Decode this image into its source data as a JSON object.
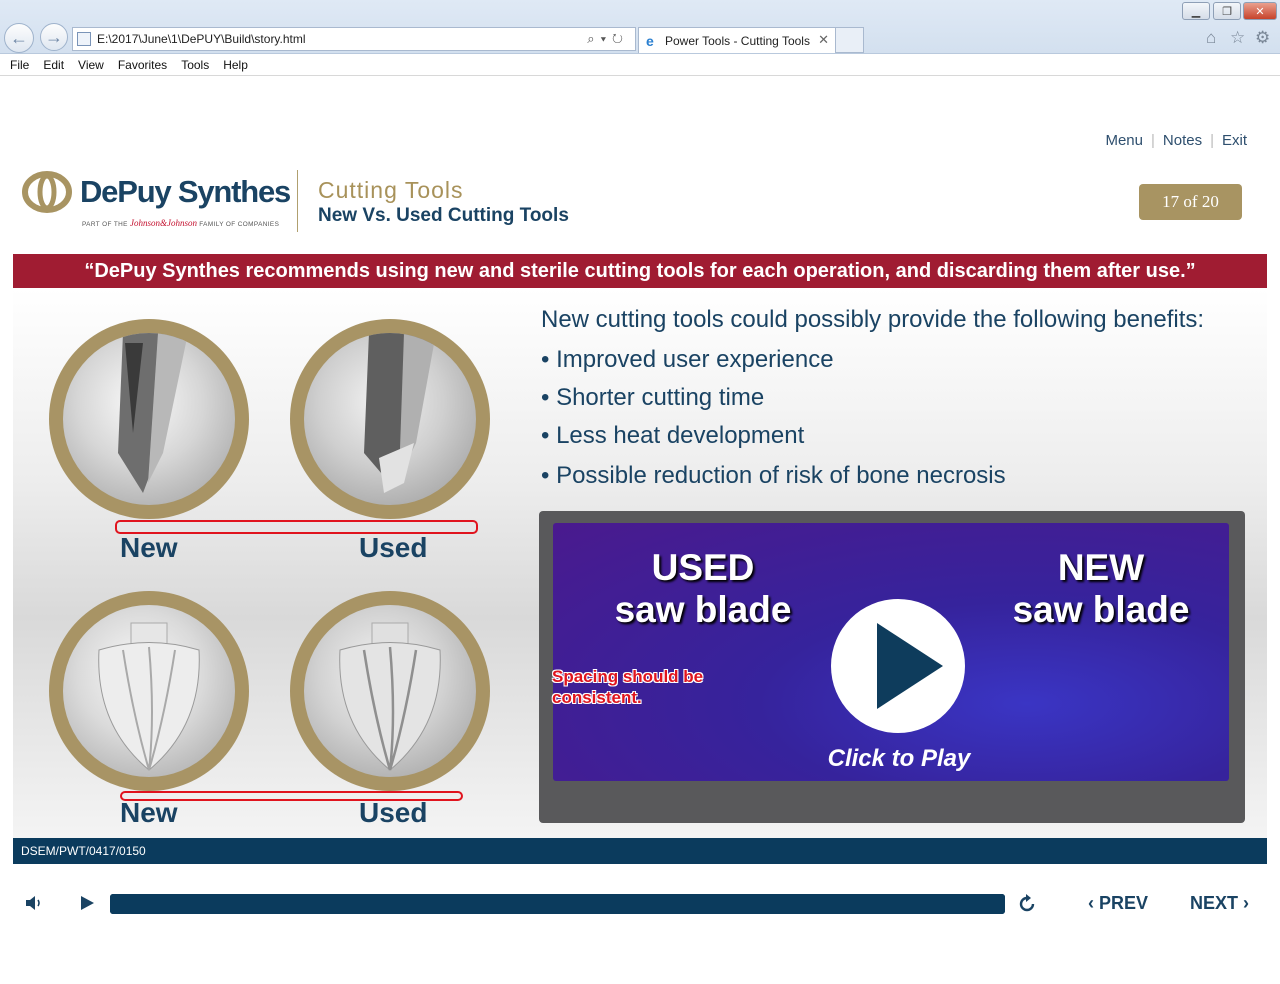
{
  "browser": {
    "address": "E:\\2017\\June\\1\\DePUY\\Build\\story.html",
    "tab_title": "Power Tools - Cutting Tools",
    "menu": [
      "File",
      "Edit",
      "View",
      "Favorites",
      "Tools",
      "Help"
    ]
  },
  "top_links": {
    "menu": "Menu",
    "notes": "Notes",
    "exit": "Exit",
    "separator": "|"
  },
  "logo": {
    "brand": "DePuy Synthes",
    "sub_prefix": "PART OF THE",
    "sub_jj": "Johnson&Johnson",
    "sub_suffix": "FAMILY OF COMPANIES"
  },
  "module": {
    "title": "Cutting Tools",
    "subtitle": "New Vs. Used Cutting Tools"
  },
  "pager": "17 of 20",
  "banner": "“DePuy Synthes recommends using new and sterile cutting tools for each operation, and discarding them after use.”",
  "images": {
    "label_new": "New",
    "label_used": "Used"
  },
  "benefits": {
    "intro": "New cutting tools could possibly provide the following benefits:",
    "items": [
      "• Improved user experience",
      "• Shorter cutting time",
      "• Less heat development",
      "• Possible reduction of risk of bone necrosis"
    ]
  },
  "video": {
    "left_title_1": "USED",
    "left_title_2": "saw blade",
    "right_title_1": "NEW",
    "right_title_2": "saw blade",
    "play_label": "Click to Play"
  },
  "review_note": {
    "line1": "Spacing should be",
    "line2": "consistent."
  },
  "footer_code": "DSEM/PWT/0417/0150",
  "player": {
    "prev": "PREV",
    "next": "NEXT",
    "progress": 1.0
  },
  "colors": {
    "navy": "#1a4363",
    "gold": "#a89462",
    "banner_red": "#a01c32",
    "footer": "#0b3b5d"
  }
}
